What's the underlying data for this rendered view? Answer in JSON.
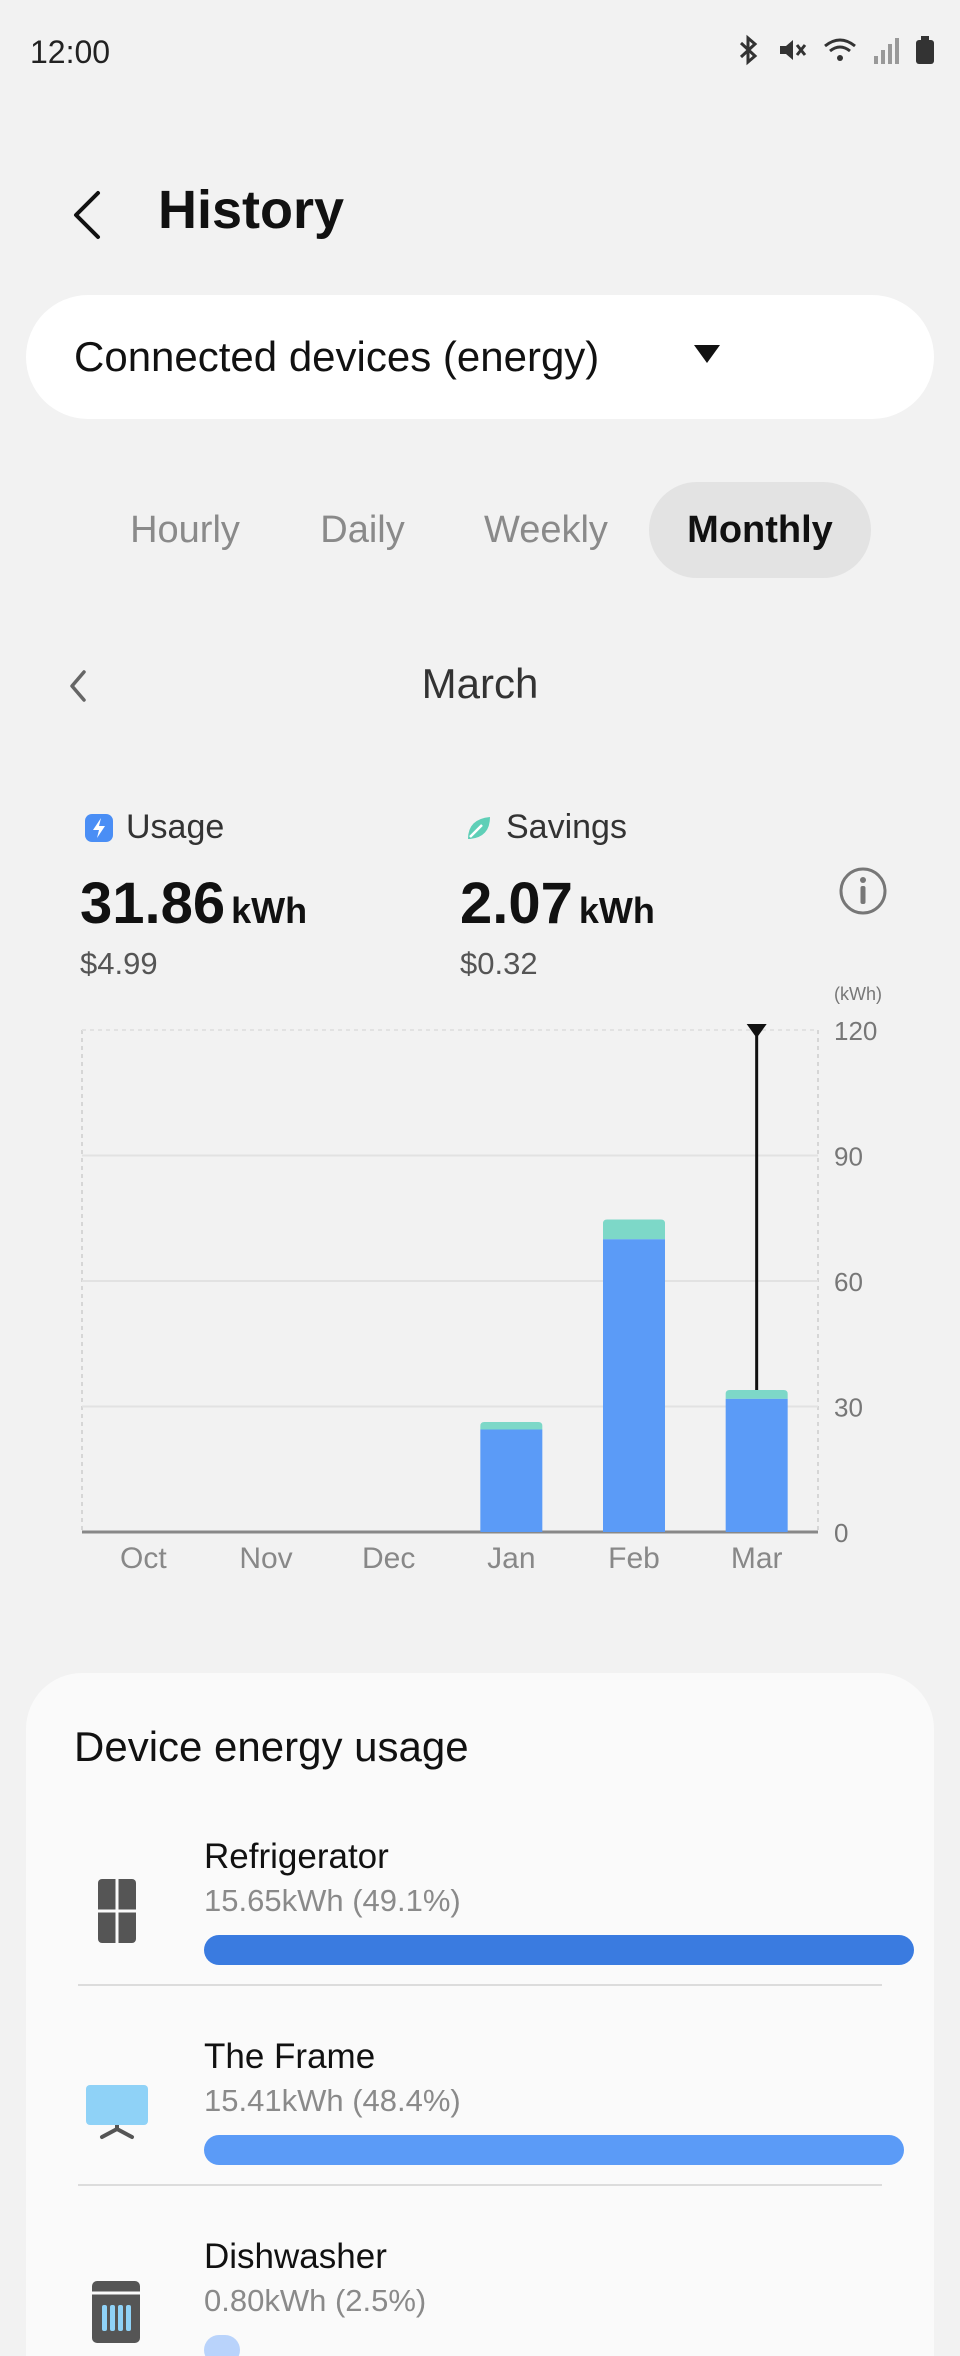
{
  "status_bar": {
    "time": "12:00",
    "icons": [
      "bluetooth-icon",
      "mute-icon",
      "wifi-icon",
      "signal-icon",
      "battery-icon"
    ]
  },
  "header": {
    "title": "History"
  },
  "device_selector": {
    "selected": "Connected devices (energy)"
  },
  "tabs": [
    {
      "label": "Hourly",
      "active": false
    },
    {
      "label": "Daily",
      "active": false
    },
    {
      "label": "Weekly",
      "active": false
    },
    {
      "label": "Monthly",
      "active": true
    }
  ],
  "period": {
    "label": "March"
  },
  "usage": {
    "label": "Usage",
    "value": "31.86",
    "unit": "kWh",
    "cost": "$4.99"
  },
  "savings": {
    "label": "Savings",
    "value": "2.07",
    "unit": "kWh",
    "cost": "$0.32"
  },
  "colors": {
    "usage_bar": "#5b9bf7",
    "savings_bar": "#7dd8c8",
    "bar_dark": "#3a7be0",
    "background": "#f2f2f2"
  },
  "chart_data": {
    "type": "bar",
    "categories": [
      "Oct",
      "Nov",
      "Dec",
      "Jan",
      "Feb",
      "Mar"
    ],
    "series": [
      {
        "name": "Usage",
        "values": [
          0,
          0,
          0,
          24.5,
          70,
          31.86
        ]
      },
      {
        "name": "Savings",
        "values": [
          0,
          0,
          0,
          1.8,
          4.7,
          2.07
        ]
      }
    ],
    "unit_label": "(kWh)",
    "yticks": [
      0,
      30,
      60,
      90,
      120
    ],
    "ylim": [
      0,
      120
    ],
    "selected_category": "Mar",
    "grid": true
  },
  "device_card": {
    "title": "Device energy usage",
    "devices": [
      {
        "name": "Refrigerator",
        "usage": "15.65kWh (49.1%)",
        "share": 0.491,
        "icon": "refrigerator-icon",
        "bar_color": "#3a7be0"
      },
      {
        "name": "The Frame",
        "usage": "15.41kWh (48.4%)",
        "share": 0.484,
        "icon": "tv-icon",
        "bar_color": "#5b9bf7"
      },
      {
        "name": "Dishwasher",
        "usage": "0.80kWh (2.5%)",
        "share": 0.025,
        "icon": "dishwasher-icon",
        "bar_color": "#b9d3fb"
      }
    ]
  }
}
